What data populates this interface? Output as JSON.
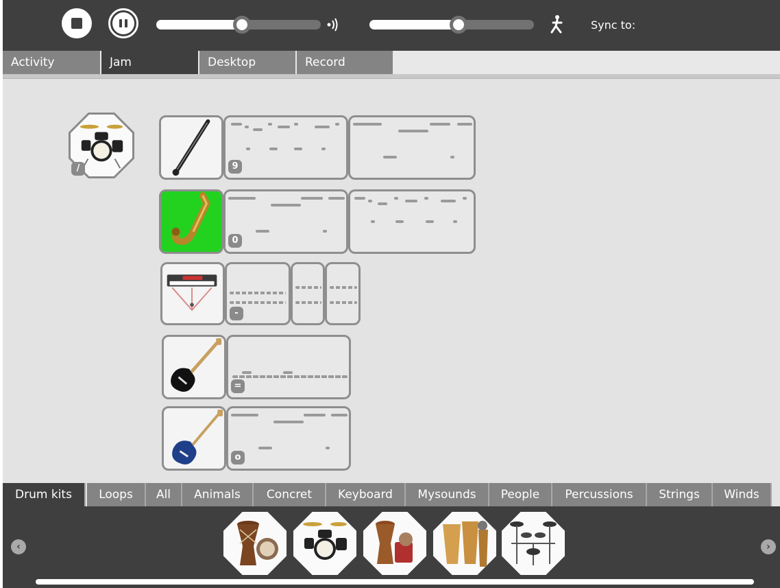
{
  "toolbar": {
    "stop_button": "stop",
    "pause_button": "pause",
    "volume_level": 0.52,
    "tempo_level": 0.54,
    "volume_icon": "speaker-icon",
    "tempo_icon": "running-figure-icon",
    "sync_label": "Sync to:"
  },
  "tabs": [
    {
      "label": "Activity",
      "active": false
    },
    {
      "label": "Jam",
      "active": true
    },
    {
      "label": "Desktop",
      "active": false
    },
    {
      "label": "Record",
      "active": false
    }
  ],
  "drum_slot": {
    "icon": "drum-kit-icon",
    "badge": "/"
  },
  "tracks": [
    {
      "instrument": "clarinet-icon",
      "active": false,
      "badge": "9"
    },
    {
      "instrument": "saxophone-icon",
      "active": true,
      "badge": "0"
    },
    {
      "instrument": "keyboard-icon",
      "active": false,
      "badge": "-"
    },
    {
      "instrument": "electric-guitar-icon",
      "active": false,
      "badge": "="
    },
    {
      "instrument": "bass-guitar-icon",
      "active": false,
      "badge": "o"
    }
  ],
  "categories": [
    {
      "label": "Drum kits",
      "active": true
    },
    {
      "label": "Loops",
      "active": false
    },
    {
      "label": "All",
      "active": false
    },
    {
      "label": "Animals",
      "active": false
    },
    {
      "label": "Concret",
      "active": false
    },
    {
      "label": "Keyboard",
      "active": false
    },
    {
      "label": "Mysounds",
      "active": false
    },
    {
      "label": "People",
      "active": false
    },
    {
      "label": "Percussions",
      "active": false
    },
    {
      "label": "Strings",
      "active": false
    },
    {
      "label": "Winds",
      "active": false
    }
  ],
  "palette_items": [
    "djembe-icon",
    "drum-kit-icon",
    "hand-drums-icon",
    "congas-icon",
    "electronic-drum-kit-icon"
  ],
  "palette_arrows": {
    "left": "chevron-left-icon",
    "right": "chevron-right-icon"
  }
}
